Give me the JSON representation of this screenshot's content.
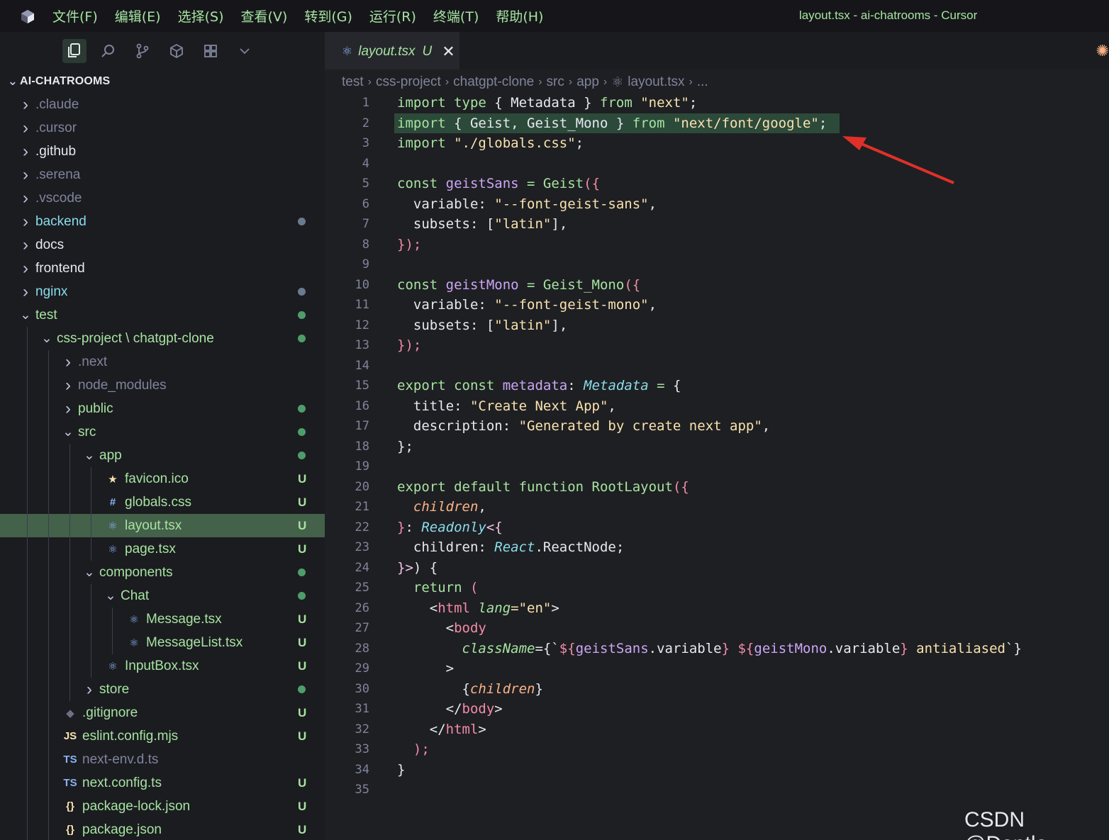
{
  "titlebar": {
    "menu": [
      "文件(F)",
      "编辑(E)",
      "选择(S)",
      "查看(V)",
      "转到(G)",
      "运行(R)",
      "终端(T)",
      "帮助(H)"
    ],
    "window_title": "layout.tsx - ai-chatrooms - Cursor"
  },
  "activity_icons": [
    "files-icon",
    "search-icon",
    "source-control-icon",
    "extensions-icon",
    "grid-icon",
    "chevron-down-icon"
  ],
  "tab": {
    "name": "layout.tsx",
    "status": "U",
    "close": "✕"
  },
  "breadcrumb": [
    "test",
    "css-project",
    "chatgpt-clone",
    "src",
    "app",
    "layout.tsx",
    "..."
  ],
  "explorer": {
    "title": "AI-CHATROOMS",
    "items": [
      {
        "label": ".claude",
        "type": "folder",
        "depth": 0,
        "open": false,
        "dim": true
      },
      {
        "label": ".cursor",
        "type": "folder",
        "depth": 0,
        "open": false,
        "dim": true
      },
      {
        "label": ".github",
        "type": "folder",
        "depth": 0,
        "open": false
      },
      {
        "label": ".serena",
        "type": "folder",
        "depth": 0,
        "open": false,
        "dim": true
      },
      {
        "label": ".vscode",
        "type": "folder",
        "depth": 0,
        "open": false,
        "dim": true
      },
      {
        "label": "backend",
        "type": "folder",
        "depth": 0,
        "open": false,
        "mark": "dot-grey",
        "color": "#89dceb"
      },
      {
        "label": "docs",
        "type": "folder",
        "depth": 0,
        "open": false
      },
      {
        "label": "frontend",
        "type": "folder",
        "depth": 0,
        "open": false
      },
      {
        "label": "nginx",
        "type": "folder",
        "depth": 0,
        "open": false,
        "mark": "dot-grey",
        "color": "#89dceb"
      },
      {
        "label": "test",
        "type": "folder",
        "depth": 0,
        "open": true,
        "mark": "dot",
        "color": "#a6e3a1"
      },
      {
        "label": "css-project \\ chatgpt-clone",
        "type": "folder",
        "depth": 1,
        "open": true,
        "mark": "dot",
        "color": "#a6e3a1"
      },
      {
        "label": ".next",
        "type": "folder",
        "depth": 2,
        "open": false,
        "dim": true
      },
      {
        "label": "node_modules",
        "type": "folder",
        "depth": 2,
        "open": false,
        "dim": true
      },
      {
        "label": "public",
        "type": "folder",
        "depth": 2,
        "open": false,
        "mark": "dot",
        "color": "#a6e3a1"
      },
      {
        "label": "src",
        "type": "folder",
        "depth": 2,
        "open": true,
        "mark": "dot",
        "color": "#a6e3a1"
      },
      {
        "label": "app",
        "type": "folder",
        "depth": 3,
        "open": true,
        "mark": "dot",
        "color": "#a6e3a1"
      },
      {
        "label": "favicon.ico",
        "type": "file",
        "depth": 4,
        "icon": "★",
        "iconColor": "#f9e2af",
        "mark": "U",
        "color": "#a6e3a1"
      },
      {
        "label": "globals.css",
        "type": "file",
        "depth": 4,
        "icon": "#",
        "iconColor": "#89b4fa",
        "mark": "U",
        "color": "#a6e3a1"
      },
      {
        "label": "layout.tsx",
        "type": "file",
        "depth": 4,
        "icon": "⚛",
        "iconColor": "#89b4fa",
        "mark": "U",
        "color": "#a6e3a1",
        "selected": true
      },
      {
        "label": "page.tsx",
        "type": "file",
        "depth": 4,
        "icon": "⚛",
        "iconColor": "#89b4fa",
        "mark": "U",
        "color": "#a6e3a1"
      },
      {
        "label": "components",
        "type": "folder",
        "depth": 3,
        "open": true,
        "mark": "dot",
        "color": "#a6e3a1"
      },
      {
        "label": "Chat",
        "type": "folder",
        "depth": 4,
        "open": true,
        "mark": "dot",
        "color": "#a6e3a1"
      },
      {
        "label": "Message.tsx",
        "type": "file",
        "depth": 5,
        "icon": "⚛",
        "iconColor": "#89b4fa",
        "mark": "U",
        "color": "#a6e3a1"
      },
      {
        "label": "MessageList.tsx",
        "type": "file",
        "depth": 5,
        "icon": "⚛",
        "iconColor": "#89b4fa",
        "mark": "U",
        "color": "#a6e3a1"
      },
      {
        "label": "InputBox.tsx",
        "type": "file",
        "depth": 4,
        "icon": "⚛",
        "iconColor": "#89b4fa",
        "mark": "U",
        "color": "#a6e3a1"
      },
      {
        "label": "store",
        "type": "folder",
        "depth": 3,
        "open": false,
        "mark": "dot",
        "color": "#a6e3a1"
      },
      {
        "label": ".gitignore",
        "type": "file",
        "depth": 2,
        "icon": "◆",
        "iconColor": "#6c7086",
        "mark": "U",
        "color": "#a6e3a1"
      },
      {
        "label": "eslint.config.mjs",
        "type": "file",
        "depth": 2,
        "icon": "JS",
        "iconColor": "#f9e2af",
        "mark": "U",
        "color": "#a6e3a1"
      },
      {
        "label": "next-env.d.ts",
        "type": "file",
        "depth": 2,
        "icon": "TS",
        "iconColor": "#89b4fa",
        "dim": true
      },
      {
        "label": "next.config.ts",
        "type": "file",
        "depth": 2,
        "icon": "TS",
        "iconColor": "#89b4fa",
        "mark": "U",
        "color": "#a6e3a1"
      },
      {
        "label": "package-lock.json",
        "type": "file",
        "depth": 2,
        "icon": "{}",
        "iconColor": "#f9e2af",
        "mark": "U",
        "color": "#a6e3a1"
      },
      {
        "label": "package.json",
        "type": "file",
        "depth": 2,
        "icon": "{}",
        "iconColor": "#f9e2af",
        "mark": "U",
        "color": "#a6e3a1"
      }
    ]
  },
  "code_lines": [
    [
      [
        "import",
        "k"
      ],
      [
        " type ",
        "k"
      ],
      [
        "{ Metadata } ",
        "p"
      ],
      [
        "from ",
        "k"
      ],
      [
        "\"next\"",
        "s"
      ],
      [
        ";",
        "p"
      ]
    ],
    [
      [
        "import ",
        "k"
      ],
      [
        "{ Geist, Geist_Mono } ",
        "p"
      ],
      [
        "from ",
        "k"
      ],
      [
        "\"next/font/google\"",
        "s"
      ],
      [
        ";",
        "p"
      ]
    ],
    [
      [
        "import ",
        "k"
      ],
      [
        "\"./globals.css\"",
        "s"
      ],
      [
        ";",
        "p"
      ]
    ],
    [],
    [
      [
        "const ",
        "k"
      ],
      [
        "geistSans ",
        "v"
      ],
      [
        "= ",
        "k"
      ],
      [
        "Geist",
        "f"
      ],
      [
        "({",
        "br"
      ]
    ],
    [
      [
        "  variable: ",
        "p"
      ],
      [
        "\"--font-geist-sans\"",
        "s"
      ],
      [
        ",",
        "p"
      ]
    ],
    [
      [
        "  subsets: ",
        "p"
      ],
      [
        "[",
        "p"
      ],
      [
        "\"latin\"",
        "s"
      ],
      [
        "],",
        "p"
      ]
    ],
    [
      [
        "});",
        "br"
      ]
    ],
    [],
    [
      [
        "const ",
        "k"
      ],
      [
        "geistMono ",
        "v"
      ],
      [
        "= ",
        "k"
      ],
      [
        "Geist_Mono",
        "f"
      ],
      [
        "({",
        "br"
      ]
    ],
    [
      [
        "  variable: ",
        "p"
      ],
      [
        "\"--font-geist-mono\"",
        "s"
      ],
      [
        ",",
        "p"
      ]
    ],
    [
      [
        "  subsets: ",
        "p"
      ],
      [
        "[",
        "p"
      ],
      [
        "\"latin\"",
        "s"
      ],
      [
        "],",
        "p"
      ]
    ],
    [
      [
        "});",
        "br"
      ]
    ],
    [],
    [
      [
        "export ",
        "k"
      ],
      [
        "const ",
        "k"
      ],
      [
        "metadata",
        "v"
      ],
      [
        ": ",
        "p"
      ],
      [
        "Metadata ",
        "t"
      ],
      [
        "= ",
        "k"
      ],
      [
        "{",
        "p"
      ]
    ],
    [
      [
        "  title: ",
        "p"
      ],
      [
        "\"Create Next App\"",
        "s"
      ],
      [
        ",",
        "p"
      ]
    ],
    [
      [
        "  description: ",
        "p"
      ],
      [
        "\"Generated by create next app\"",
        "s"
      ],
      [
        ",",
        "p"
      ]
    ],
    [
      [
        "};",
        "p"
      ]
    ],
    [],
    [
      [
        "export ",
        "k"
      ],
      [
        "default ",
        "k"
      ],
      [
        "function ",
        "k"
      ],
      [
        "RootLayout",
        "f"
      ],
      [
        "({",
        "br"
      ]
    ],
    [
      [
        "  ",
        "p"
      ],
      [
        "children",
        "it"
      ],
      [
        ",",
        "p"
      ]
    ],
    [
      [
        "}",
        "br"
      ],
      [
        ": ",
        "p"
      ],
      [
        "Readonly",
        "t"
      ],
      [
        "<{",
        "pr"
      ]
    ],
    [
      [
        "  children: ",
        "p"
      ],
      [
        "React",
        "t"
      ],
      [
        ".ReactNode;",
        "p"
      ]
    ],
    [
      [
        "}>",
        "pr"
      ],
      [
        ") {",
        "p"
      ]
    ],
    [
      [
        "  return ",
        "k"
      ],
      [
        "(",
        "br"
      ]
    ],
    [
      [
        "    <",
        "p"
      ],
      [
        "html ",
        "tg"
      ],
      [
        "lang",
        "at"
      ],
      [
        "=\"en\"",
        "s"
      ],
      [
        ">",
        "p"
      ]
    ],
    [
      [
        "      <",
        "p"
      ],
      [
        "body",
        "tg"
      ]
    ],
    [
      [
        "        ",
        "p"
      ],
      [
        "className",
        "at"
      ],
      [
        "={`",
        "p"
      ],
      [
        "${",
        "br"
      ],
      [
        "geistSans",
        "v"
      ],
      [
        ".variable",
        "p"
      ],
      [
        "} ",
        "br"
      ],
      [
        "${",
        "br"
      ],
      [
        "geistMono",
        "v"
      ],
      [
        ".variable",
        "p"
      ],
      [
        "} ",
        "br"
      ],
      [
        "antialiased",
        "s"
      ],
      [
        "`}",
        "p"
      ]
    ],
    [
      [
        "      >",
        "p"
      ]
    ],
    [
      [
        "        {",
        "p"
      ],
      [
        "children",
        "it"
      ],
      [
        "}",
        "p"
      ]
    ],
    [
      [
        "      </",
        "p"
      ],
      [
        "body",
        "tg"
      ],
      [
        ">",
        "p"
      ]
    ],
    [
      [
        "    </",
        "p"
      ],
      [
        "html",
        "tg"
      ],
      [
        ">",
        "p"
      ]
    ],
    [
      [
        "  );",
        "br"
      ]
    ],
    [
      [
        "}",
        "p"
      ]
    ],
    []
  ],
  "highlighted_line": 2,
  "watermark": "CSDN @Dontla",
  "colors": {
    "accent": "#a6e3a1",
    "selection": "#44614a",
    "highlight": "#2c4a3a",
    "arrow": "#e0302a"
  }
}
